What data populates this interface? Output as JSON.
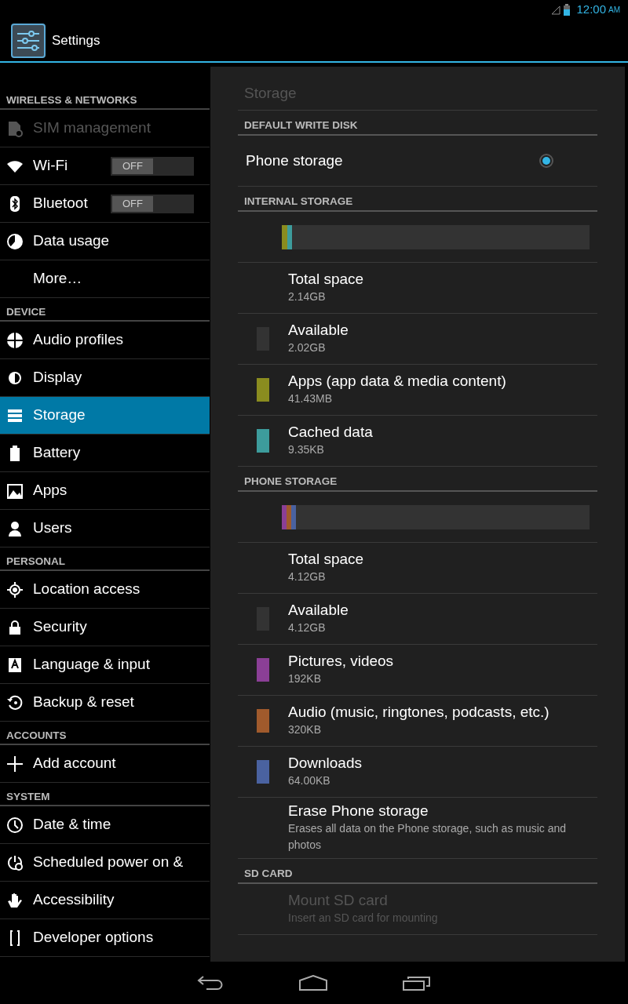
{
  "status_bar": {
    "time": "12:00",
    "ampm": "AM"
  },
  "action_bar": {
    "title": "Settings"
  },
  "sidebar": {
    "sections": [
      {
        "header": "WIRELESS & NETWORKS",
        "items": [
          {
            "label": "SIM management",
            "disabled": true,
            "selected": false
          },
          {
            "label": "Wi-Fi",
            "disabled": false,
            "selected": false,
            "toggle": {
              "label": "OFF",
              "on": false
            }
          },
          {
            "label": "Bluetoot",
            "disabled": false,
            "selected": false,
            "toggle": {
              "label": "OFF",
              "on": false
            }
          },
          {
            "label": "Data usage",
            "disabled": false,
            "selected": false
          },
          {
            "label": "More…",
            "disabled": false,
            "selected": false
          }
        ]
      },
      {
        "header": "DEVICE",
        "items": [
          {
            "label": "Audio profiles",
            "disabled": false,
            "selected": false
          },
          {
            "label": "Display",
            "disabled": false,
            "selected": false
          },
          {
            "label": "Storage",
            "disabled": false,
            "selected": true
          },
          {
            "label": "Battery",
            "disabled": false,
            "selected": false
          },
          {
            "label": "Apps",
            "disabled": false,
            "selected": false
          },
          {
            "label": "Users",
            "disabled": false,
            "selected": false
          }
        ]
      },
      {
        "header": "PERSONAL",
        "items": [
          {
            "label": "Location access",
            "disabled": false,
            "selected": false
          },
          {
            "label": "Security",
            "disabled": false,
            "selected": false
          },
          {
            "label": "Language & input",
            "disabled": false,
            "selected": false
          },
          {
            "label": "Backup & reset",
            "disabled": false,
            "selected": false
          }
        ]
      },
      {
        "header": "ACCOUNTS",
        "items": [
          {
            "label": "Add account",
            "disabled": false,
            "selected": false
          }
        ]
      },
      {
        "header": "SYSTEM",
        "items": [
          {
            "label": "Date & time",
            "disabled": false,
            "selected": false
          },
          {
            "label": "Scheduled power on &",
            "disabled": false,
            "selected": false
          },
          {
            "label": "Accessibility",
            "disabled": false,
            "selected": false
          },
          {
            "label": "Developer options",
            "disabled": false,
            "selected": false
          }
        ]
      }
    ]
  },
  "panel": {
    "title": "Storage",
    "sections": [
      {
        "header": "DEFAULT WRITE DISK",
        "rows": [
          {
            "kind": "radio",
            "title": "Phone storage",
            "selected": true
          }
        ]
      },
      {
        "header": "INTERNAL STORAGE",
        "rows": [
          {
            "kind": "bar",
            "segments": [
              {
                "color": "#8a8c1f",
                "level": 0.018
              },
              {
                "color": "#3d9c9c",
                "level": 0.016
              }
            ]
          },
          {
            "kind": "info",
            "title": "Total space",
            "subtitle": "2.14GB",
            "disabled": false
          },
          {
            "kind": "info",
            "title": "Available",
            "subtitle": "2.02GB",
            "color": "#333333",
            "disabled": false
          },
          {
            "kind": "info",
            "title": "Apps (app data & media content)",
            "subtitle": "41.43MB",
            "color": "#8a8c1f",
            "disabled": false
          },
          {
            "kind": "info",
            "title": "Cached data",
            "subtitle": "9.35KB",
            "color": "#3d9c9c",
            "disabled": false
          }
        ]
      },
      {
        "header": "PHONE STORAGE",
        "rows": [
          {
            "kind": "bar",
            "segments": [
              {
                "color": "#8b3f96",
                "level": 0.015
              },
              {
                "color": "#a05a2c",
                "level": 0.015
              },
              {
                "color": "#4a62a0",
                "level": 0.015
              }
            ]
          },
          {
            "kind": "info",
            "title": "Total space",
            "subtitle": "4.12GB",
            "disabled": false
          },
          {
            "kind": "info",
            "title": "Available",
            "subtitle": "4.12GB",
            "color": "#333333",
            "disabled": false
          },
          {
            "kind": "info",
            "title": "Pictures, videos",
            "subtitle": "192KB",
            "color": "#8b3f96",
            "disabled": false
          },
          {
            "kind": "info",
            "title": "Audio (music, ringtones, podcasts, etc.)",
            "subtitle": "320KB",
            "color": "#a05a2c",
            "disabled": false
          },
          {
            "kind": "info",
            "title": "Downloads",
            "subtitle": "64.00KB",
            "color": "#4a62a0",
            "disabled": false
          },
          {
            "kind": "info",
            "title": "Erase Phone storage",
            "subtitle": "Erases all data on the Phone storage, such as music and photos",
            "disabled": false
          }
        ]
      },
      {
        "header": "SD CARD",
        "rows": [
          {
            "kind": "info",
            "title": "Mount SD card",
            "subtitle": "Insert an SD card for mounting",
            "disabled": true
          }
        ]
      }
    ]
  }
}
